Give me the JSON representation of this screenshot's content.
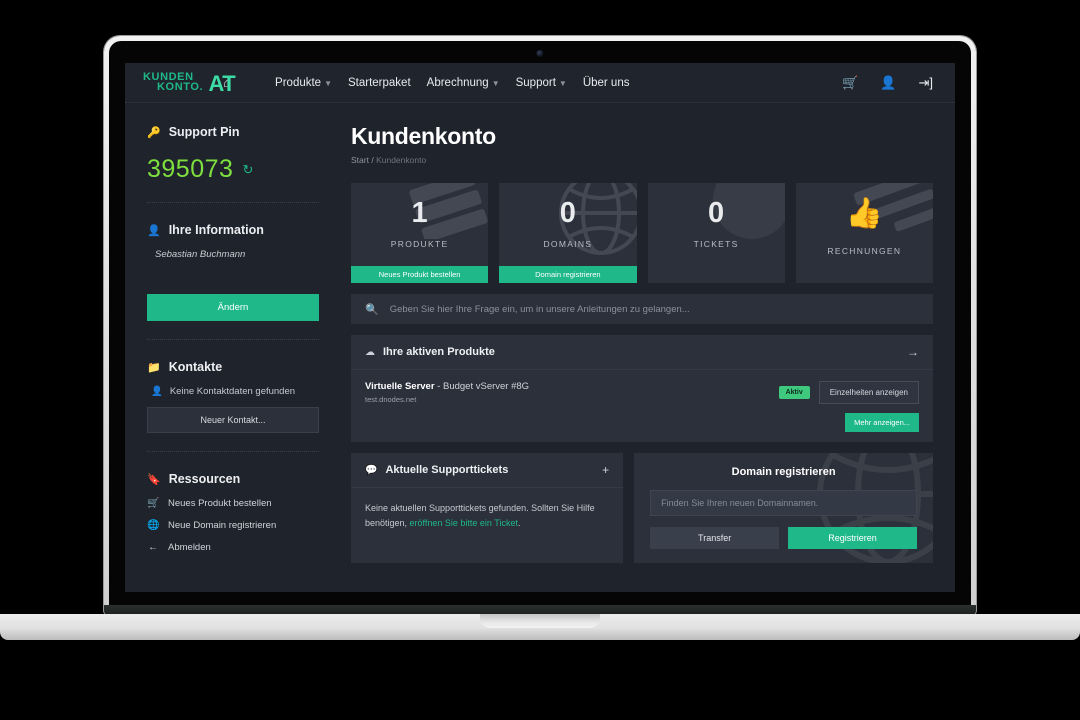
{
  "brand": {
    "logo_line1": "KUNDEN",
    "logo_line2": "KONTO.",
    "logo_tld": "AT",
    "accent": "#1fb888",
    "accent_light": "#3ddba6",
    "pin_color": "#7ee03f"
  },
  "topnav": {
    "home_icon": "home-icon",
    "items": [
      {
        "label": "Produkte",
        "has_caret": true
      },
      {
        "label": "Starterpaket",
        "has_caret": false
      },
      {
        "label": "Abrechnung",
        "has_caret": true
      },
      {
        "label": "Support",
        "has_caret": true
      },
      {
        "label": "Über uns",
        "has_caret": false
      }
    ],
    "right_icons": [
      "cart-icon",
      "user-icon",
      "logout-icon"
    ]
  },
  "sidebar": {
    "support_pin": {
      "title": "Support Pin",
      "icon": "key-icon",
      "value": "395073",
      "refresh_icon": "refresh-icon"
    },
    "information": {
      "title": "Ihre Information",
      "icon": "user-icon",
      "name": "Sebastian Buchmann",
      "change_button": "Ändern"
    },
    "contacts": {
      "title": "Kontakte",
      "icon": "folder-icon",
      "empty_text": "Keine Kontaktdaten gefunden",
      "new_contact_button": "Neuer Kontakt..."
    },
    "resources": {
      "title": "Ressourcen",
      "icon": "bookmark-icon",
      "items": [
        {
          "label": "Neues Produkt bestellen",
          "icon": "cart-icon"
        },
        {
          "label": "Neue Domain registrieren",
          "icon": "globe-icon"
        },
        {
          "label": "Abmelden",
          "icon": "arrow-left-icon"
        }
      ]
    }
  },
  "main": {
    "title": "Kundenkonto",
    "breadcrumb_root": "Start",
    "breadcrumb_sep": "/",
    "breadcrumb_current": "Kundenkonto",
    "cards": [
      {
        "value": "1",
        "label": "PRODUKTE",
        "cta": "Neues Produkt bestellen",
        "deco": "servers"
      },
      {
        "value": "0",
        "label": "DOMAINS",
        "cta": "Domain registrieren",
        "deco": "globe"
      },
      {
        "value": "0",
        "label": "TICKETS",
        "cta": "",
        "deco": "circle"
      },
      {
        "value": "",
        "label": "RECHNUNGEN",
        "cta": "",
        "deco": "bill",
        "icon": "thumbs-up-icon"
      }
    ],
    "search_placeholder": "Geben Sie hier Ihre Frage ein, um in unsere Anleitungen zu gelangen...",
    "search_icon": "search-icon",
    "products_panel": {
      "title": "Ihre aktiven Produkte",
      "icon": "cloud-icon",
      "arrow_icon": "arrow-right-icon",
      "rows": [
        {
          "name_bold": "Virtuelle Server",
          "name_rest": " - Budget vServer #8G",
          "hostname": "test.dnodes.net",
          "status": "Aktiv",
          "details_button": "Einzelheiten anzeigen"
        }
      ],
      "more_button": "Mehr anzeigen..."
    },
    "tickets_panel": {
      "title": "Aktuelle Supporttickets",
      "icon": "comments-icon",
      "add_icon": "plus-icon",
      "body_before": "Keine aktuellen Supporttickets gefunden. Sollten Sie Hilfe benötigen, ",
      "body_link": "eröffnen Sie bitte ein Ticket",
      "body_after": "."
    },
    "domain_panel": {
      "title": "Domain registrieren",
      "input_placeholder": "Finden Sie Ihren neuen Domainnamen.",
      "transfer_button": "Transfer",
      "register_button": "Registrieren"
    }
  }
}
